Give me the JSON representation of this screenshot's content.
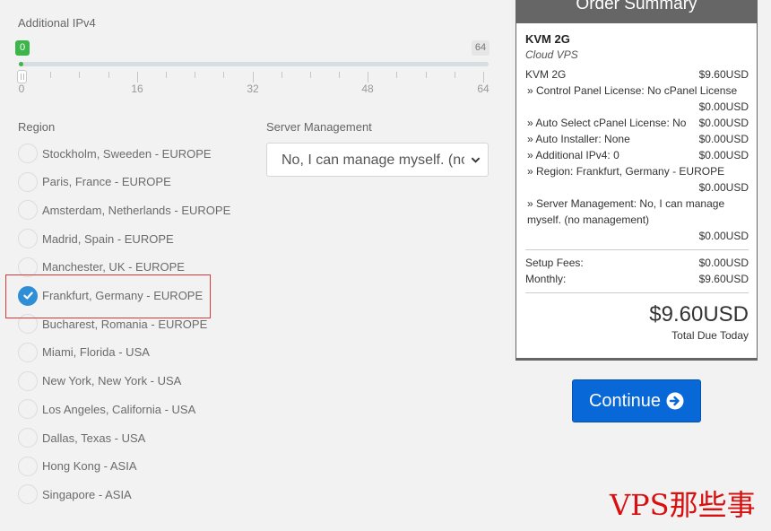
{
  "ipv4": {
    "label": "Additional IPv4",
    "current_value": "0",
    "max_value": "64",
    "ticks": [
      "0",
      "16",
      "32",
      "48",
      "64"
    ]
  },
  "region": {
    "label": "Region",
    "selected_index": 5,
    "options": [
      "Stockholm, Sweeden - EUROPE",
      "Paris, France - EUROPE",
      "Amsterdam, Netherlands - EUROPE",
      "Madrid, Spain - EUROPE",
      "Manchester, UK - EUROPE",
      "Frankfurt, Germany - EUROPE",
      "Bucharest, Romania - EUROPE",
      "Miami, Florida - USA",
      "New York, New York - USA",
      "Los Angeles, California - USA",
      "Dallas, Texas - USA",
      "Hong Kong - ASIA",
      "Singapore - ASIA"
    ]
  },
  "management": {
    "label": "Server Management",
    "selected": "No, I can manage myself. (no management)"
  },
  "summary": {
    "title": "Order Summary",
    "product_name": "KVM 2G",
    "product_group": "Cloud VPS",
    "base_label": "KVM 2G",
    "base_price": "$9.60USD",
    "options": [
      {
        "label": "» Control Panel License: No cPanel License",
        "price": "$0.00USD"
      },
      {
        "label": "» Auto Select cPanel License: No",
        "price": "$0.00USD"
      },
      {
        "label": "» Auto Installer: None",
        "price": "$0.00USD"
      },
      {
        "label": "» Additional IPv4: 0",
        "price": "$0.00USD"
      },
      {
        "label": "» Region: Frankfurt, Germany - EUROPE",
        "price": "$0.00USD"
      },
      {
        "label": "» Server Management: No, I can manage myself. (no management)",
        "price": "$0.00USD"
      }
    ],
    "setup_label": "Setup Fees:",
    "setup_value": "$0.00USD",
    "monthly_label": "Monthly:",
    "monthly_value": "$9.60USD",
    "total": "$9.60USD",
    "total_label": "Total Due Today"
  },
  "continue_label": "Continue",
  "watermark": "VPS那些事",
  "colors": {
    "accent_blue": "#0868d8",
    "check_blue": "#2f8fd6",
    "slider_green": "#3cb54a",
    "highlight_red": "#d83a3a",
    "watermark_red": "#d81010"
  }
}
